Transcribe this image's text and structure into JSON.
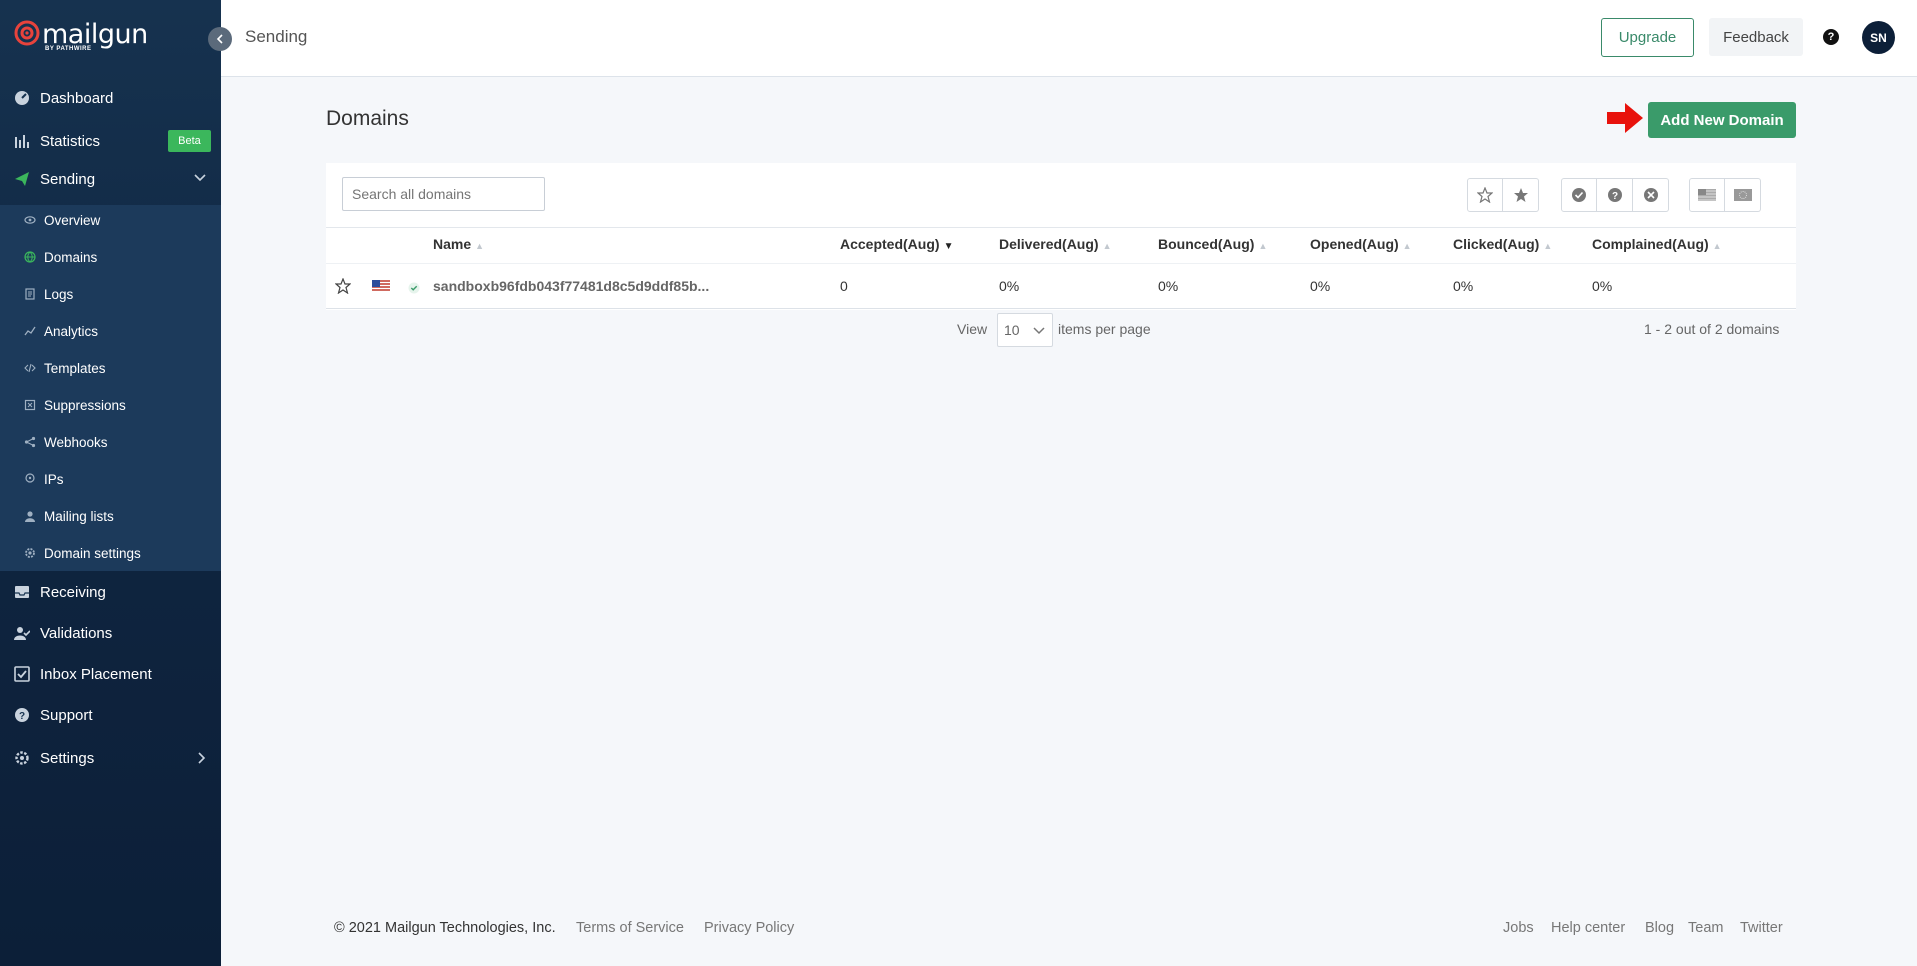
{
  "brand": {
    "name": "mailgun",
    "sub": "BY PATHWIRE"
  },
  "colors": {
    "sidebar": "#0f2540",
    "accent_green": "#3a9b6a",
    "beta_green": "#3bb75c",
    "arrow_red": "#e8120c"
  },
  "sidebar": {
    "items": [
      {
        "label": "Dashboard",
        "icon": "dashboard-icon"
      },
      {
        "label": "Statistics",
        "icon": "bar-chart-icon",
        "badge": "Beta"
      },
      {
        "label": "Sending",
        "icon": "paper-plane-icon"
      },
      {
        "label": "Receiving",
        "icon": "inbox-icon"
      },
      {
        "label": "Validations",
        "icon": "user-check-icon"
      },
      {
        "label": "Inbox Placement",
        "icon": "checkbox-icon"
      },
      {
        "label": "Support",
        "icon": "question-icon"
      },
      {
        "label": "Settings",
        "icon": "gear-icon"
      }
    ],
    "sending_sub": [
      {
        "label": "Overview",
        "icon": "eye-icon"
      },
      {
        "label": "Domains",
        "icon": "globe-icon"
      },
      {
        "label": "Logs",
        "icon": "document-icon"
      },
      {
        "label": "Analytics",
        "icon": "trend-icon"
      },
      {
        "label": "Templates",
        "icon": "code-icon"
      },
      {
        "label": "Suppressions",
        "icon": "block-icon"
      },
      {
        "label": "Webhooks",
        "icon": "share-icon"
      },
      {
        "label": "IPs",
        "icon": "location-icon"
      },
      {
        "label": "Mailing lists",
        "icon": "user-icon"
      },
      {
        "label": "Domain settings",
        "icon": "settings-icon"
      }
    ]
  },
  "header": {
    "title": "Sending",
    "upgrade_label": "Upgrade",
    "feedback_label": "Feedback",
    "help_label": "?",
    "avatar_initials": "SN"
  },
  "main": {
    "title": "Domains",
    "add_button_label": "Add New Domain",
    "search_placeholder": "Search all domains",
    "columns": [
      "Name",
      "Accepted(Aug)",
      "Delivered(Aug)",
      "Bounced(Aug)",
      "Opened(Aug)",
      "Clicked(Aug)",
      "Complained(Aug)"
    ],
    "rows": [
      {
        "name": "sandboxb96fdb043f77481d8c5d9ddf85b...",
        "accepted": "0",
        "delivered": "0%",
        "bounced": "0%",
        "opened": "0%",
        "clicked": "0%",
        "complained": "0%"
      }
    ],
    "pager": {
      "view_label": "View",
      "per_page_value": "10",
      "items_label": "items per page",
      "summary": "1 - 2 out of 2 domains"
    }
  },
  "footer": {
    "copyright": "© 2021 Mailgun Technologies, Inc.",
    "left_links": [
      "Terms of Service",
      "Privacy Policy"
    ],
    "right_links": [
      "Jobs",
      "Help center",
      "Blog",
      "Team",
      "Twitter"
    ]
  }
}
